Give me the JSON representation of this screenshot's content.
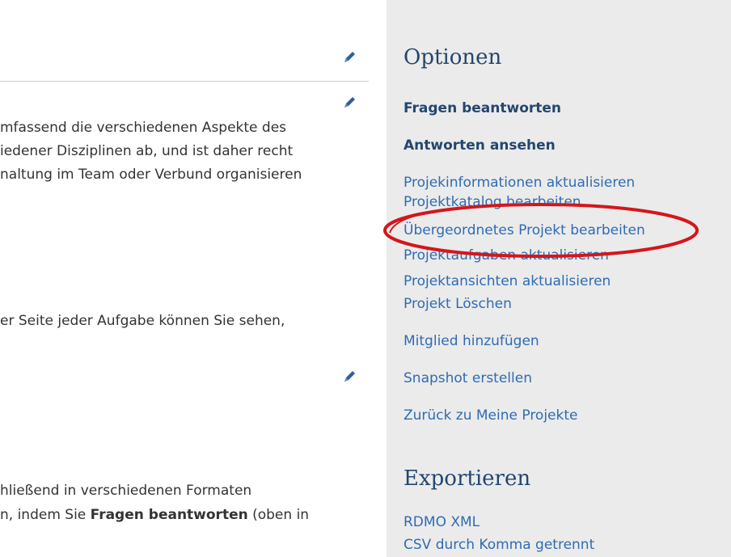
{
  "main": {
    "paragraph1": [
      "mfassend die verschiedenen Aspekte des",
      "iedener Disziplinen ab, und ist daher recht",
      "naltung im Team oder Verbund organisieren"
    ],
    "paragraph2": "er Seite jeder Aufgabe können Sie sehen,",
    "paragraph3": {
      "line1": "hließend in verschiedenen Formaten",
      "line2_prefix": "n, indem Sie ",
      "line2_bold": "Fragen beantworten",
      "line2_suffix": " (oben in"
    }
  },
  "sidebar": {
    "options_heading": "Optionen",
    "options": [
      {
        "label": "Fragen beantworten"
      },
      {
        "label": "Antworten ansehen"
      },
      {
        "label": "Projekinformationen aktualisieren"
      },
      {
        "label": "Projektkatalog bearbeiten"
      },
      {
        "label": "Übergeordnetes Projekt bearbeiten"
      },
      {
        "label": "Projektaufgaben aktualisieren"
      },
      {
        "label": "Projektansichten aktualisieren"
      },
      {
        "label": "Projekt Löschen"
      },
      {
        "label": "Mitglied hinzufügen"
      },
      {
        "label": "Snapshot erstellen"
      },
      {
        "label": "Zurück zu Meine Projekte"
      }
    ],
    "export_heading": "Exportieren",
    "exports": [
      {
        "label": "RDMO XML"
      },
      {
        "label": "CSV durch Komma getrennt"
      }
    ]
  },
  "colors": {
    "link": "#2f6bb3",
    "heading": "#23466f",
    "sidebar_bg": "#ebebeb",
    "annotation": "#d4161c"
  },
  "icons": {
    "edit": "pencil-icon"
  }
}
